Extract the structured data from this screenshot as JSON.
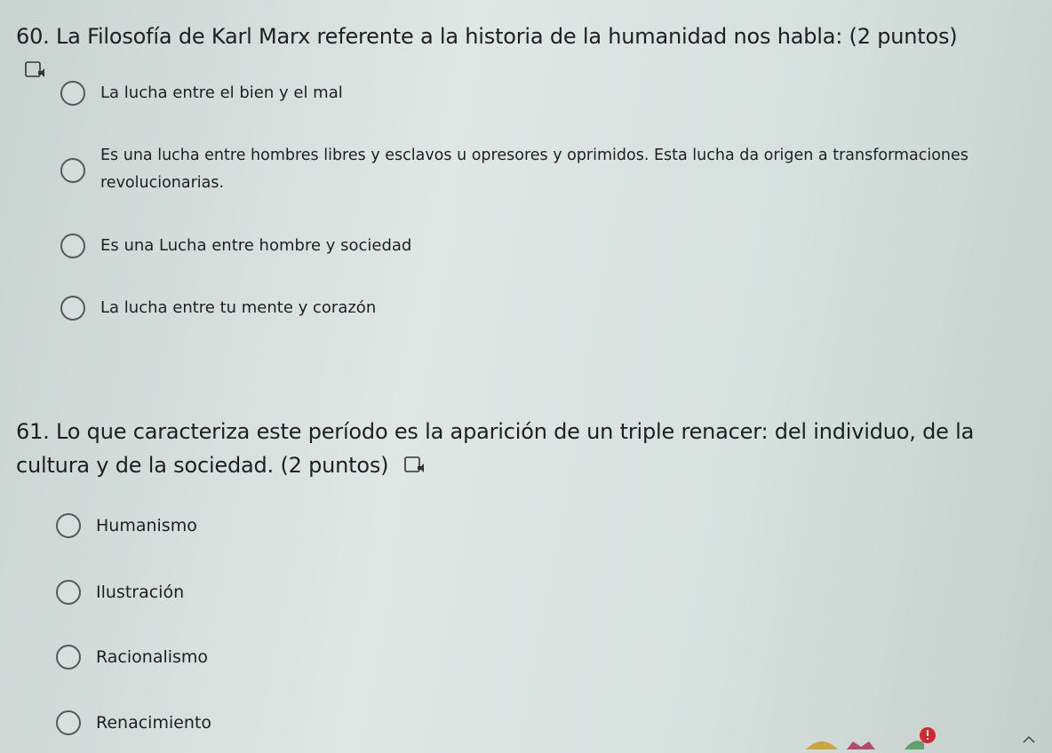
{
  "questions": [
    {
      "title": "60. La Filosofía de Karl Marx referente a la historia de la humanidad nos habla:",
      "points": "(2 puntos)",
      "options": [
        "La lucha entre el bien y el mal",
        "Es una lucha entre hombres libres y esclavos u opresores y oprimidos. Esta lucha da origen a transformaciones revolucionarias.",
        "Es una Lucha entre hombre y sociedad",
        "La lucha entre tu mente y corazón"
      ]
    },
    {
      "title": "61. Lo que caracteriza este período es la aparición de un triple renacer: del individuo, de la cultura y de la sociedad.",
      "points": "(2 puntos)",
      "options": [
        "Humanismo",
        "Ilustración",
        "Racionalismo",
        "Renacimiento"
      ]
    }
  ],
  "icons": {
    "read_aloud": "speaker-icon",
    "taskbar": [
      "image-icon",
      "mail-icon",
      "notification-icon",
      "chevron-up-icon"
    ]
  },
  "colors": {
    "background": "#dfe7e5",
    "text": "#1d1f22",
    "radio_border": "#55585c"
  }
}
